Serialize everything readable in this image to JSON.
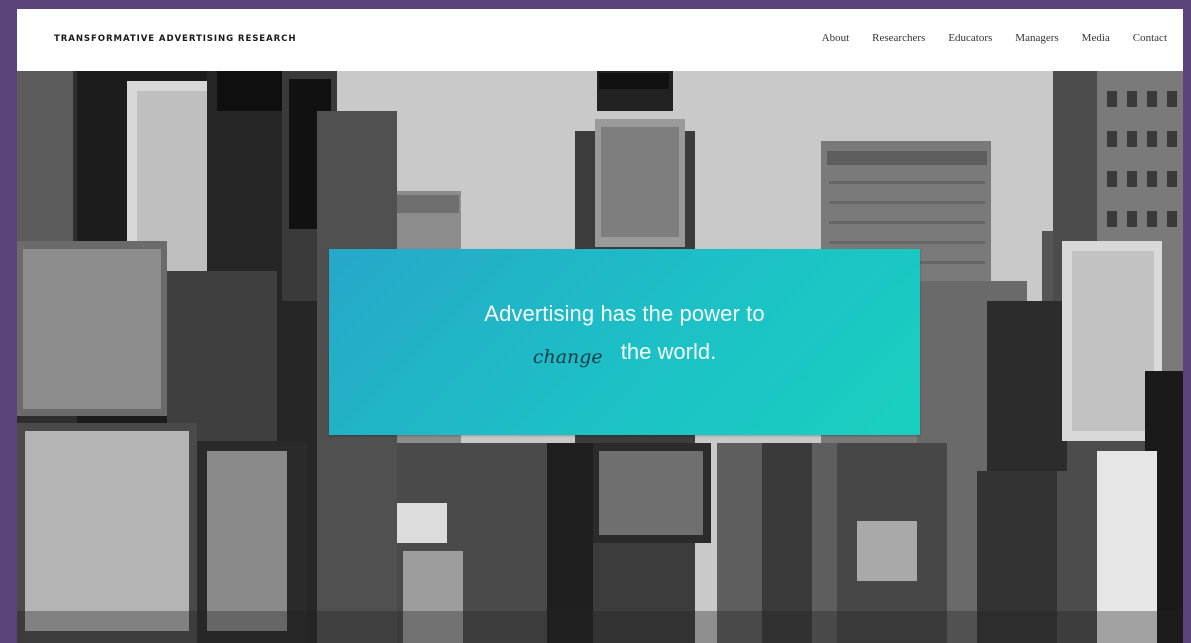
{
  "brand": "TRANSFORMATIVE ADVERTISING RESEARCH",
  "nav": [
    "About",
    "Researchers",
    "Educators",
    "Managers",
    "Media",
    "Contact"
  ],
  "hero": {
    "line1": "Advertising has the power to",
    "script_word": "change",
    "line2_rest": "the world."
  },
  "colors": {
    "page_border": "#5a4479",
    "banner_start": "#27a7c9",
    "banner_end": "#19d0bf"
  }
}
